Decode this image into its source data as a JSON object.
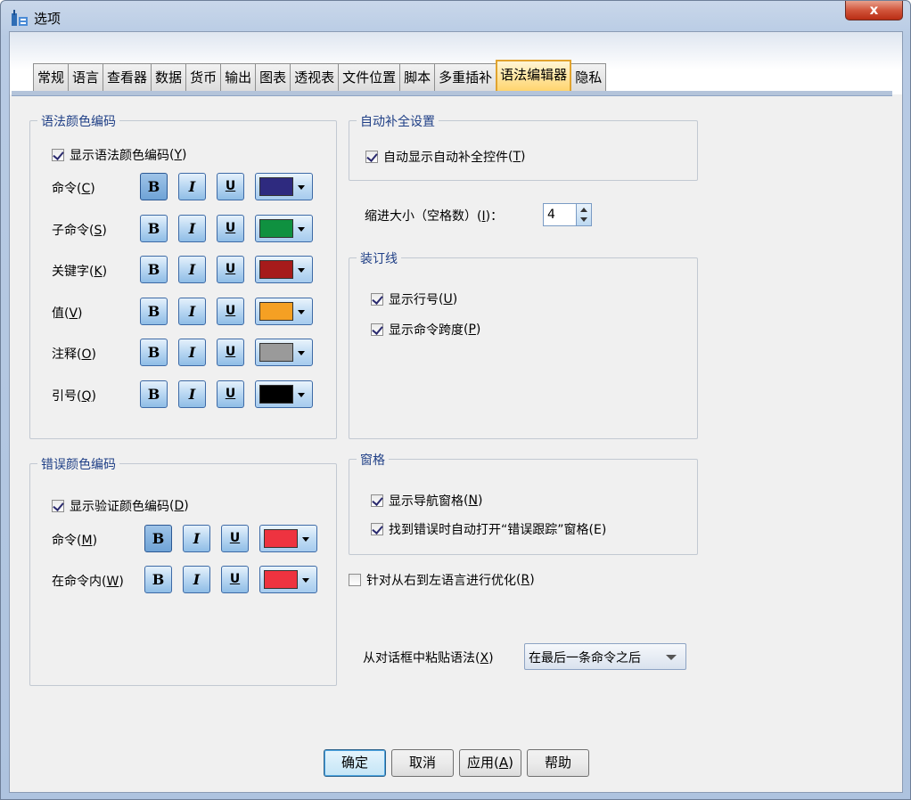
{
  "window": {
    "title": "选项",
    "close_label": "x"
  },
  "tabs": [
    {
      "label": "常规"
    },
    {
      "label": "语言"
    },
    {
      "label": "查看器"
    },
    {
      "label": "数据"
    },
    {
      "label": "货币"
    },
    {
      "label": "输出"
    },
    {
      "label": "图表"
    },
    {
      "label": "透视表"
    },
    {
      "label": "文件位置"
    },
    {
      "label": "脚本"
    },
    {
      "label": "多重插补"
    },
    {
      "label": "语法编辑器",
      "active": true
    },
    {
      "label": "隐私"
    }
  ],
  "syntax_color": {
    "title": "语法颜色编码",
    "show_label": "显示语法颜色编码",
    "show_key": "Y",
    "show_checked": true,
    "rows": [
      {
        "label": "命令",
        "key": "C",
        "bold": true,
        "italic": false,
        "underline": false,
        "color": "#2e2a7f"
      },
      {
        "label": "子命令",
        "key": "S",
        "bold": true,
        "italic": false,
        "underline": false,
        "color": "#0f9140"
      },
      {
        "label": "关键字",
        "key": "K",
        "bold": true,
        "italic": false,
        "underline": false,
        "color": "#a61b1b"
      },
      {
        "label": "值",
        "key": "V",
        "bold": true,
        "italic": false,
        "underline": false,
        "color": "#f5a023"
      },
      {
        "label": "注释",
        "key": "O",
        "bold": true,
        "italic": false,
        "underline": false,
        "color": "#9a9a9a"
      },
      {
        "label": "引号",
        "key": "Q",
        "bold": true,
        "italic": false,
        "underline": false,
        "color": "#000000"
      }
    ]
  },
  "error_color": {
    "title": "错误颜色编码",
    "show_label": "显示验证颜色编码",
    "show_key": "D",
    "show_checked": true,
    "rows": [
      {
        "label": "命令",
        "key": "M",
        "color": "#ee3340"
      },
      {
        "label": "在命令内",
        "key": "W",
        "color": "#ee3340"
      }
    ]
  },
  "autocomplete": {
    "title": "自动补全设置",
    "label": "自动显示自动补全控件",
    "key": "T",
    "checked": true
  },
  "indent": {
    "label": "缩进大小（空格数）",
    "key": "I",
    "suffix": "：",
    "value": "4"
  },
  "gutter": {
    "title": "装订线",
    "line_numbers": {
      "label": "显示行号",
      "key": "U",
      "checked": true
    },
    "command_span": {
      "label": "显示命令跨度",
      "key": "P",
      "checked": true
    }
  },
  "panes": {
    "title": "窗格",
    "nav": {
      "label": "显示导航窗格",
      "key": "N",
      "checked": true
    },
    "error_trace": {
      "label": "找到错误时自动打开“错误跟踪”窗格(E)",
      "checked": true
    }
  },
  "rtl": {
    "label": "针对从右到左语言进行优化",
    "key": "R",
    "checked": false
  },
  "paste": {
    "label": "从对话框中粘贴语法",
    "key": "X",
    "value": "在最后一条命令之后"
  },
  "buttons": {
    "ok": "确定",
    "cancel": "取消",
    "apply": "应用",
    "apply_key": "A",
    "help": "帮助"
  },
  "format_glyphs": {
    "bold": "B",
    "italic": "I",
    "underline": "U"
  }
}
